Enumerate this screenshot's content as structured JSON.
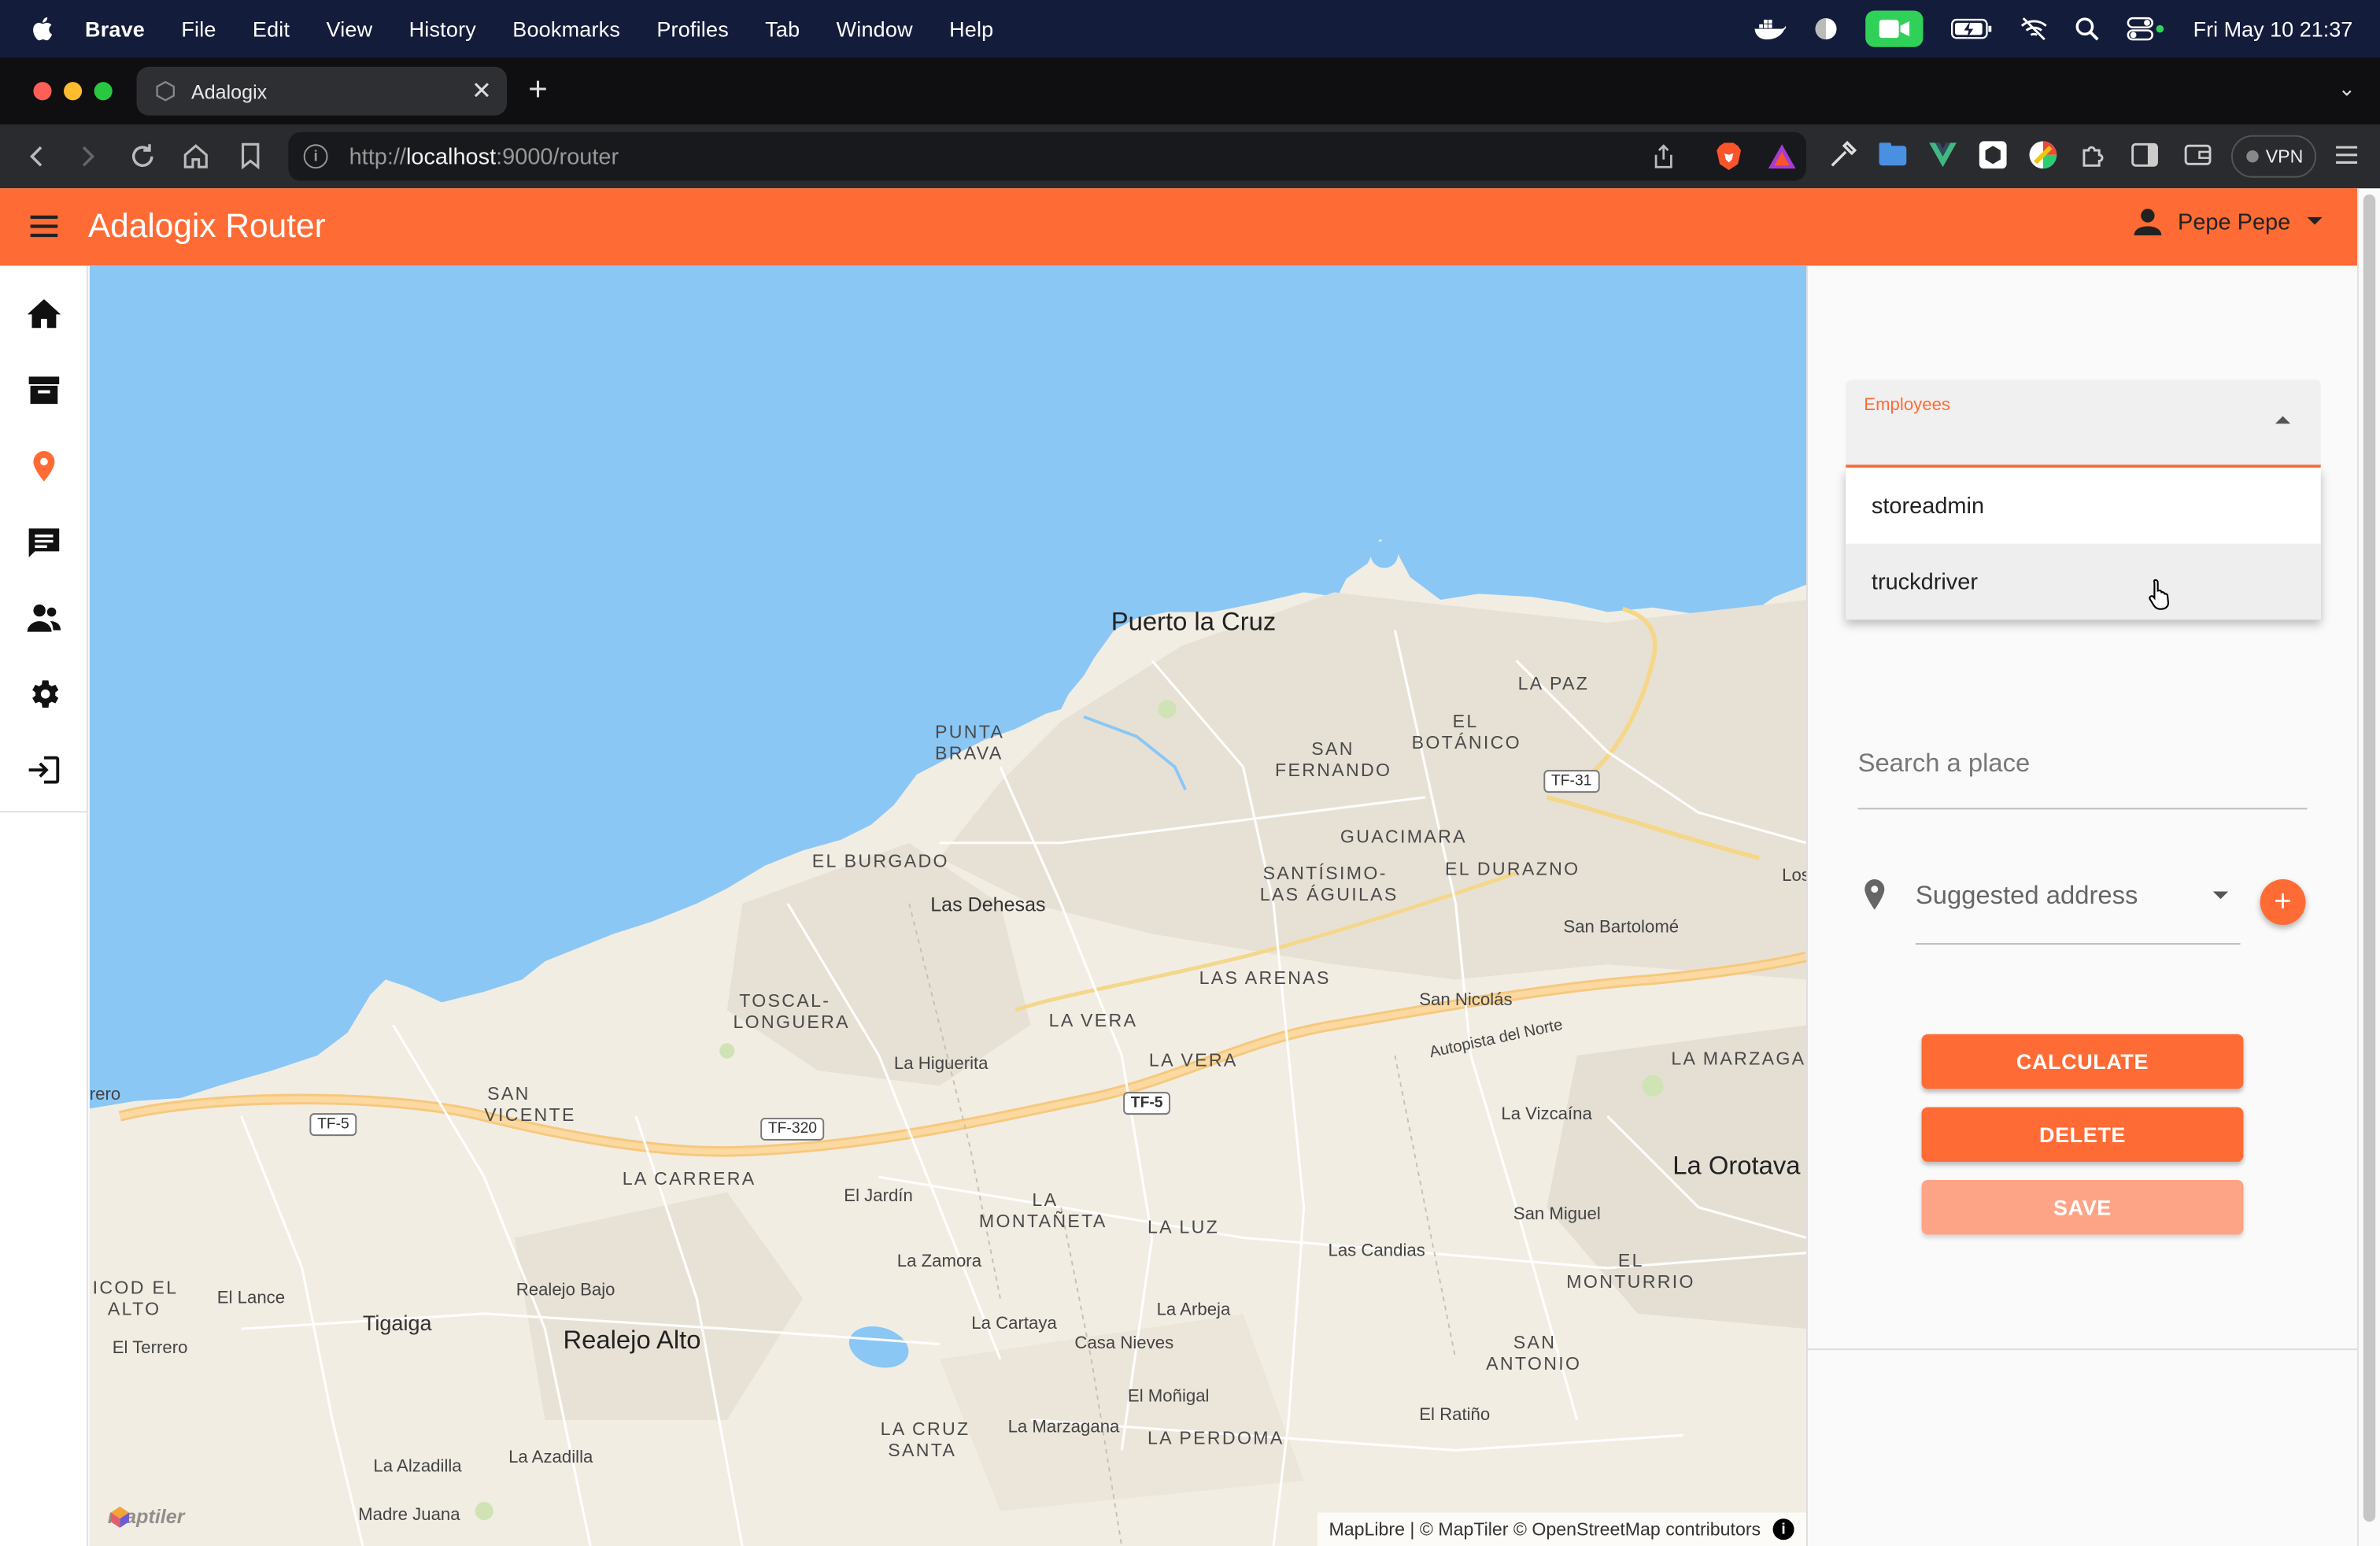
{
  "menubar": {
    "app_name": "Brave",
    "items": [
      "File",
      "Edit",
      "View",
      "History",
      "Bookmarks",
      "Profiles",
      "Tab",
      "Window",
      "Help"
    ],
    "clock": "Fri May 10  21:37"
  },
  "browser": {
    "tab_title": "Adalogix",
    "url_scheme": "http://",
    "url_host": "localhost",
    "url_rest": ":9000/router",
    "vpn_label": "VPN"
  },
  "app": {
    "title": "Adalogix Router",
    "user_name": "Pepe Pepe",
    "accent_color": "#ff6b35"
  },
  "sidenav": {
    "items": [
      "home-icon",
      "archive-icon",
      "location-pin-icon",
      "chat-icon",
      "people-icon",
      "gear-icon",
      "logout-icon"
    ],
    "active": "location-pin-icon"
  },
  "map": {
    "labels": {
      "puerto_la_cruz": "Puerto la Cruz",
      "punta": "PUNTA",
      "brava": "BRAVA",
      "la_paz": "LA PAZ",
      "el": "EL",
      "botanico": "BOTÁNICO",
      "san": "SAN",
      "fernando": "FERNANDO",
      "el_burgado": "EL BURGADO",
      "las_dehesas": "Las Dehesas",
      "guacimara": "GUACIMARA",
      "santisimo": "SANTÍSIMO-",
      "las_aguilas": "LAS ÁGUILAS",
      "el_durazno": "EL DURAZNO",
      "los": "Los",
      "san_bartolome": "San Bartolomé",
      "toscal": "TOSCAL-",
      "longuera": "LONGUERA",
      "las_arenas": "LAS ARENAS",
      "san_nicolas": "San Nicolás",
      "la_vera_1": "LA VERA",
      "la_vera_2": "LA VERA",
      "la_higuerita": "La Higuerita",
      "autopista": "Autopista del Norte",
      "la_marzaga": "LA MARZAGA",
      "rero": "rero",
      "san_vicente_1": "SAN",
      "san_vicente_2": "VICENTE",
      "la_vizcaina": "La Vizcaína",
      "la_carrera": "LA CARRERA",
      "la_orotava": "La Orotava",
      "el_jardin": "El Jardín",
      "la": "LA",
      "montaneta": "MONTAÑETA",
      "la_luz": "LA LUZ",
      "san_miguel": "San Miguel",
      "icod_el": "ICOD EL",
      "alto": "ALTO",
      "el_lance": "El Lance",
      "realejo_bajo": "Realejo Bajo",
      "la_zamora": "La Zamora",
      "las_candias": "Las Candias",
      "el_monturrio_1": "EL",
      "el_monturrio_2": "MONTURRIO",
      "tigaiga": "Tigaiga",
      "realejo_alto": "Realejo Alto",
      "la_arbeja": "La Arbeja",
      "la_cartaya": "La Cartaya",
      "casa_nieves": "Casa Nieves",
      "el_terrero": "El Terrero",
      "san_antonio_1": "SAN",
      "san_antonio_2": "ANTONIO",
      "el_monigal": "El Moñigal",
      "el_ratino": "El Ratiño",
      "la_cruz_santa_1": "LA CRUZ",
      "la_cruz_santa_2": "SANTA",
      "la_marzagana": "La Marzagana",
      "la_perdoma": "LA PERDOMA",
      "la_alzadilla": "La Alzadilla",
      "la_azadilla": "La Azadilla",
      "madre_juana": "Madre Juana"
    },
    "shields": {
      "tf31": "TF-31",
      "tf5a": "TF-5",
      "tf320": "TF-320",
      "tf5b": "TF-5"
    },
    "logo_text": "maptiler",
    "attribution": "MapLibre | © MapTiler © OpenStreetMap contributors"
  },
  "panel": {
    "employees_label": "Employees",
    "employee_options": [
      "storeadmin",
      "truckdriver"
    ],
    "hovered_option": "truckdriver",
    "search_placeholder": "Search a place",
    "suggested_placeholder": "Suggested address",
    "add_label": "+",
    "calculate_label": "CALCULATE",
    "delete_label": "DELETE",
    "save_label": "SAVE"
  }
}
